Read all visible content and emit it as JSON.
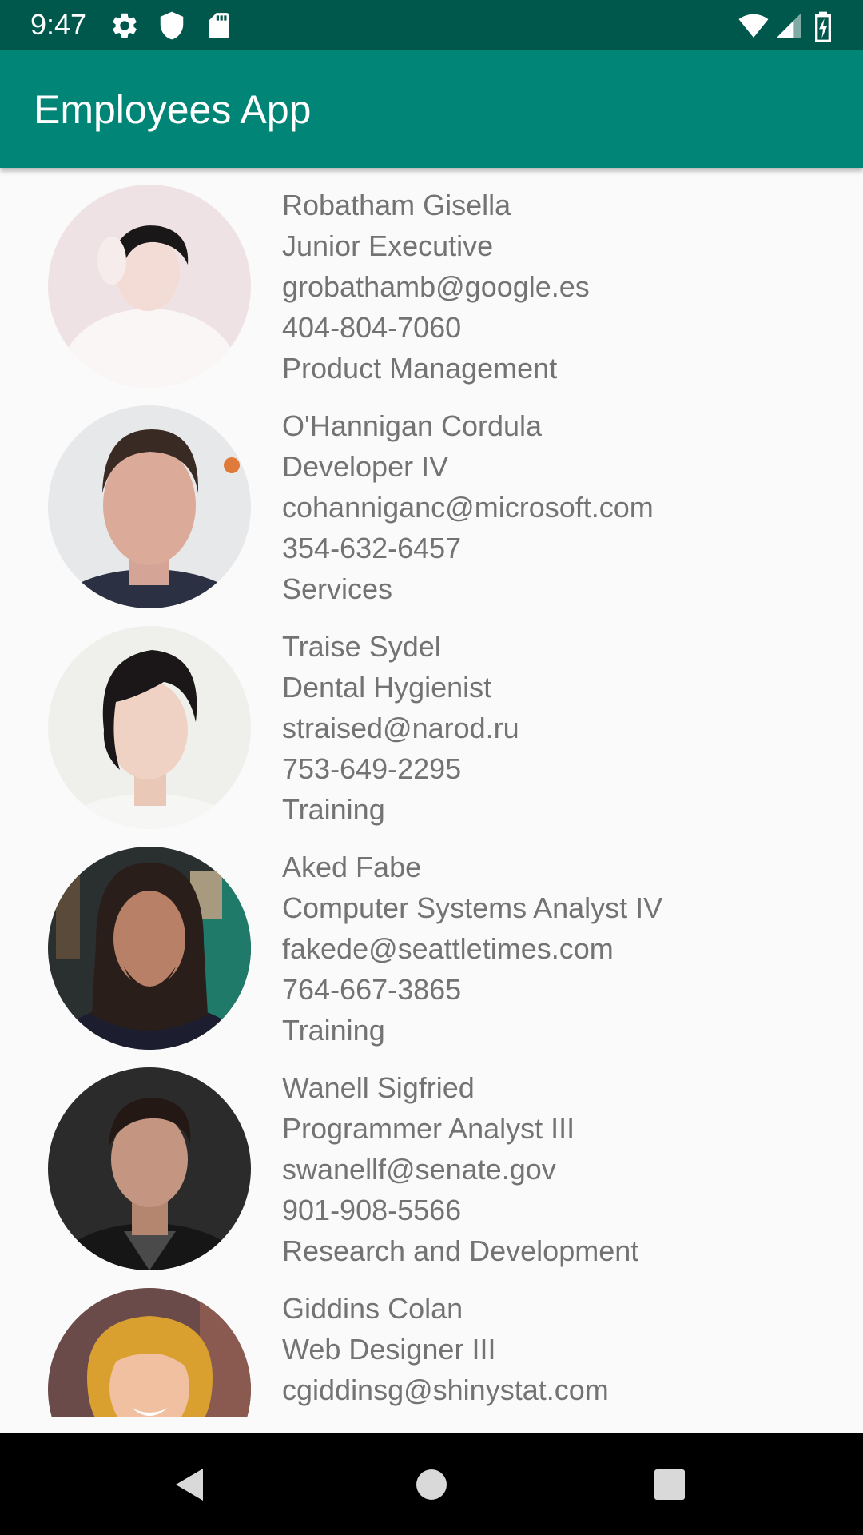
{
  "status_bar": {
    "time": "9:47",
    "left_icons": [
      "gear-icon",
      "shield-icon",
      "sd-card-icon"
    ],
    "right_icons": [
      "wifi-icon",
      "cell-signal-icon",
      "battery-charging-icon"
    ]
  },
  "app_bar": {
    "title": "Employees App",
    "color": "#008577",
    "status_color": "#00574b"
  },
  "employees": [
    {
      "name": "Robatham Gisella",
      "title": "Junior Executive",
      "email": "grobathamb@google.es",
      "phone": "404-804-7060",
      "department": "Product Management"
    },
    {
      "name": "O'Hannigan Cordula",
      "title": "Developer IV",
      "email": "cohanniganc@microsoft.com",
      "phone": "354-632-6457",
      "department": "Services"
    },
    {
      "name": "Traise Sydel",
      "title": "Dental Hygienist",
      "email": "straised@narod.ru",
      "phone": "753-649-2295",
      "department": "Training"
    },
    {
      "name": "Aked Fabe",
      "title": "Computer Systems Analyst IV",
      "email": "fakede@seattletimes.com",
      "phone": "764-667-3865",
      "department": "Training"
    },
    {
      "name": "Wanell Sigfried",
      "title": "Programmer Analyst III",
      "email": "swanellf@senate.gov",
      "phone": "901-908-5566",
      "department": "Research and Development"
    },
    {
      "name": "Giddins Colan",
      "title": "Web Designer III",
      "email": "cgiddinsg@shinystat.com"
    }
  ],
  "nav_bar": {
    "buttons": [
      "back-icon",
      "home-icon",
      "recents-icon"
    ]
  }
}
